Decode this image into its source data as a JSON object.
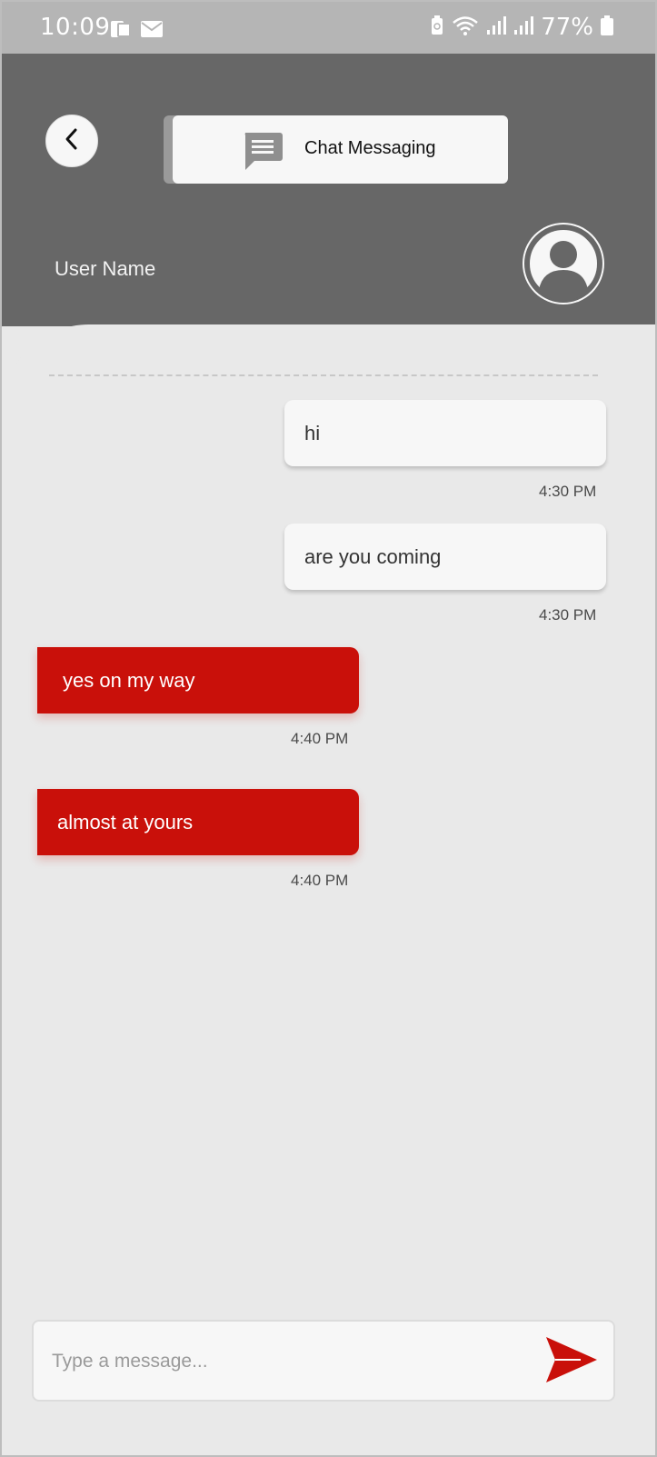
{
  "status_bar": {
    "time": "10:09",
    "battery": "77%",
    "icons": [
      "photo-icon",
      "mail-icon",
      "battery-saver-icon",
      "wifi-icon",
      "signal-icon",
      "signal-icon",
      "battery-icon"
    ]
  },
  "header": {
    "title": "Chat Messaging",
    "user_name": "User Name",
    "back_icon": "chevron-left-icon",
    "title_icon": "chat-icon",
    "avatar_icon": "person-icon"
  },
  "messages": [
    {
      "direction": "in",
      "text": "hi",
      "time": "4:30 PM"
    },
    {
      "direction": "in",
      "text": "are you coming",
      "time": "4:30 PM"
    },
    {
      "direction": "out",
      "text": "yes on my way",
      "time": "4:40 PM"
    },
    {
      "direction": "out",
      "text": "almost at yours",
      "time": "4:40 PM"
    }
  ],
  "composer": {
    "placeholder": "Type a message...",
    "value": "",
    "send_icon": "send-icon"
  },
  "colors": {
    "accent": "#c9100a",
    "header": "#676767",
    "statusbar": "#b5b5b5",
    "background": "#e9e9e9",
    "bubble_incoming": "#f7f7f7"
  }
}
